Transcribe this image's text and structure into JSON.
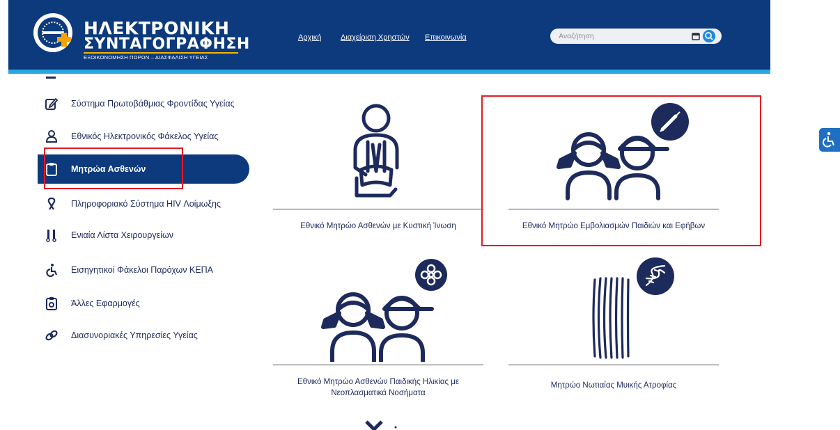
{
  "header": {
    "logo_line1": "ΗΛΕΚΤΡΟΝΙΚΗ",
    "logo_line2": "ΣΥΝΤΑΓΟΓΡΑΦΗΣΗ",
    "logo_sub": "ΕΞΟΙΚΟΝΟΜΗΣΗ ΠΟΡΩΝ – ΔΙΑΣΦΑΛΙΣΗ ΥΓΕΙΑΣ",
    "nav": [
      "Αρχική",
      "Διαχείριση Χρηστών",
      "Επικοινωνία"
    ],
    "search_placeholder": "Αναζήτηση"
  },
  "sidebar": {
    "items": [
      {
        "label": "Σύστημα Πρωτοβάθμιας Φροντίδας Υγείας",
        "icon": "edit-icon"
      },
      {
        "label": "Εθνικός Ηλεκτρονικός Φάκελος Υγείας",
        "icon": "user-icon"
      },
      {
        "label": "Μητρώα Ασθενών",
        "icon": "clipboard-icon",
        "active": true
      },
      {
        "label": "Πληροφοριακό Σύστημα HIV Λοίμωξης",
        "icon": "ribbon-icon"
      },
      {
        "label": "Ενιαία Λίστα Χειρουργείων",
        "icon": "surgical-tools-icon"
      },
      {
        "label": "Εισηγητικοί Φάκελοι Παρόχων ΚΕΠΑ",
        "icon": "wheelchair-icon"
      },
      {
        "label": "Άλλες Εφαρμογές",
        "icon": "clipboard-check-icon"
      },
      {
        "label": "Διασυνοριακές Υπηρεσίες Υγείας",
        "icon": "link-icon"
      }
    ]
  },
  "cards": [
    {
      "label": "Εθνικό Μητρώο Ασθενών με Κυστική Ίνωση"
    },
    {
      "label": "Εθνικό Μητρώο Εμβολιασμών Παιδιών και Εφήβων"
    },
    {
      "label_line1": "Εθνικό Μητρώο Ασθενών  Παιδικής Ηλικίας  με",
      "label_line2": "Νεοπλασματικά Νοσήματα"
    },
    {
      "label": "Μητρώο  Νωτιαίας Μυικής Ατροφίας"
    }
  ],
  "colors": {
    "brand": "#0c3a7c",
    "accent": "#2aa6e0",
    "highlight": "#e21b23",
    "text": "#1d2a5c"
  }
}
